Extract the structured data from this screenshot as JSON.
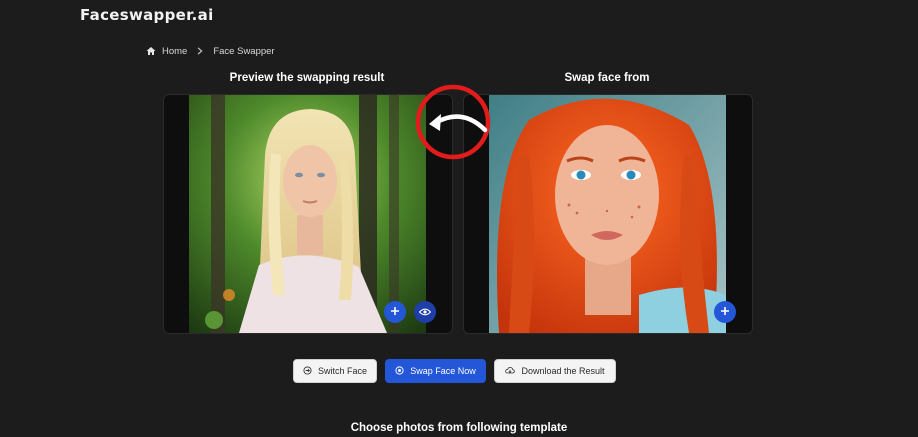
{
  "brand": {
    "logo_text": "Faceswapper.ai"
  },
  "breadcrumb": {
    "home_label": "Home",
    "current_label": "Face Swapper"
  },
  "preview_panel": {
    "title": "Preview the swapping result"
  },
  "source_panel": {
    "title": "Swap face from"
  },
  "actions": {
    "switch_label": "Switch Face",
    "swap_label": "Swap Face Now",
    "download_label": "Download the Result"
  },
  "templates": {
    "title": "Choose photos from following template"
  },
  "colors": {
    "background": "#1c1c1d",
    "accent": "#2456d8",
    "annotation": "#e21b1b"
  },
  "icons": {
    "home": "home-icon",
    "chevron": "chevron-right-icon",
    "plus": "plus-icon",
    "eye": "eye-icon",
    "switch": "switch-face-icon",
    "swap": "swap-icon",
    "download": "download-cloud-icon"
  }
}
